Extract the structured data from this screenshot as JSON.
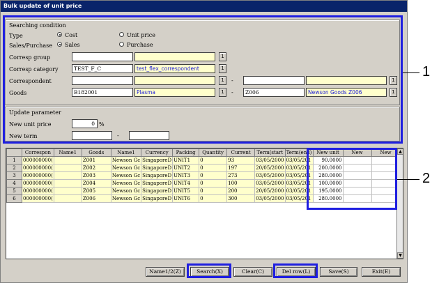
{
  "window": {
    "title": "Bulk update of unit price"
  },
  "search": {
    "section_label": "Searching condition",
    "type_label": "Type",
    "type_options": [
      "Cost",
      "Unit price"
    ],
    "type_selected": "Cost",
    "salespurchase_label": "Sales/Purchase",
    "sp_options": [
      "Sales",
      "Purchase"
    ],
    "sp_selected": "Sales",
    "corresp_group_label": "Corresp group",
    "corresp_group_code": "",
    "corresp_group_name": "",
    "corresp_category_label": "Corresp category",
    "corresp_category_code": "TEST_F_C",
    "corresp_category_name": "test_flex_correspondent",
    "correspondent_label": "Correspondent",
    "correspondent_from_code": "",
    "correspondent_from_name": "",
    "correspondent_to_code": "",
    "correspondent_to_name": "",
    "goods_label": "Goods",
    "goods_from_code": "B182001",
    "goods_from_name": "Plasma",
    "goods_to_code": "Z006",
    "goods_to_name": "Newson Goods Z006",
    "picker": "1",
    "range_sep": "-"
  },
  "update": {
    "section_label": "Update parameter",
    "new_unit_price_label": "New unit price",
    "new_unit_price_value": "0",
    "percent": "%",
    "new_term_label": "New term",
    "new_term_from": "",
    "new_term_to": "",
    "range_sep": "-"
  },
  "grid": {
    "headers": [
      "",
      "Correspon",
      "Name1",
      "Goods",
      "Name1",
      "Currency",
      "Packing",
      "Quantity",
      "Current",
      "Term(start",
      "Term(end)",
      "New unit",
      "New",
      "New"
    ],
    "rows": [
      [
        "1",
        "000000000(",
        "",
        "Z001",
        "Newson Gc",
        "SingaporeD",
        "UNIT1",
        "0",
        "93",
        "03/05/2000",
        "03/05/201",
        "90.0000",
        "",
        ""
      ],
      [
        "2",
        "000000000(",
        "",
        "Z002",
        "Newson Gc",
        "SingaporeD",
        "UNIT2",
        "0",
        "197",
        "20/05/2000",
        "03/05/201",
        "200.0000",
        "",
        ""
      ],
      [
        "3",
        "000000000(",
        "",
        "Z003",
        "Newson Gc",
        "SingaporeD",
        "UNIT3",
        "0",
        "273",
        "03/05/2000",
        "03/05/201",
        "280.0000",
        "",
        ""
      ],
      [
        "4",
        "000000000(",
        "",
        "Z004",
        "Newson Gc",
        "SingaporeD",
        "UNIT4",
        "0",
        "100",
        "03/05/2000",
        "03/05/201",
        "100.0000",
        "",
        ""
      ],
      [
        "5",
        "000000000(",
        "",
        "Z005",
        "Newson Gc",
        "SingaporeD",
        "UNIT5",
        "0",
        "200",
        "20/05/2000",
        "03/05/201",
        "195.0000",
        "",
        ""
      ],
      [
        "6",
        "000000000(",
        "",
        "Z006",
        "Newson Gc",
        "SingaporeD",
        "UNIT6",
        "0",
        "300",
        "03/05/2000",
        "03/05/201",
        "280.0000",
        "",
        ""
      ]
    ]
  },
  "buttons": {
    "name": "Name1/2(Z)",
    "search": "Search(X)",
    "clear": "Clear(C)",
    "delrow": "Del row(L)",
    "save": "Save(S)",
    "exit": "Exit(E)"
  },
  "callouts": {
    "one": "1",
    "two": "2"
  },
  "colors": {
    "highlight": "#1f1fe0",
    "readonly_bg": "#ffffcc",
    "titlebar": "#0a246a"
  }
}
